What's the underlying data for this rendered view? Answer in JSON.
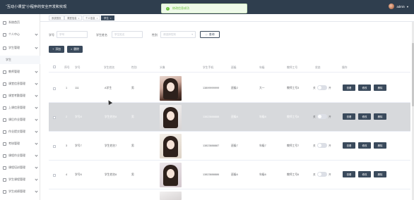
{
  "app": {
    "title": "“互动小课堂”小程序的安全开发和实现",
    "user": "admin"
  },
  "toast": {
    "text": "修改信息成功"
  },
  "sidebar": {
    "items": [
      {
        "label": "系统首页",
        "icon": "home-icon"
      },
      {
        "label": "个人中心",
        "icon": "user-icon"
      },
      {
        "label": "学生管理",
        "icon": "student-icon"
      },
      {
        "label": "学生",
        "icon": ""
      },
      {
        "label": "教师管理",
        "icon": "teacher-icon"
      },
      {
        "label": "课堂信息管理",
        "icon": "grid-icon"
      },
      {
        "label": "课堂考勤管理",
        "icon": "grid-icon"
      },
      {
        "label": "上课信息管理",
        "icon": "grid-icon"
      },
      {
        "label": "课后作业管理",
        "icon": "grid-icon"
      },
      {
        "label": "作业提交管理",
        "icon": "grid-icon"
      },
      {
        "label": "考核管理",
        "icon": "grid-icon"
      },
      {
        "label": "课程作业管理",
        "icon": "grid-icon"
      },
      {
        "label": "课程培训管理",
        "icon": "grid-icon"
      },
      {
        "label": "学生课程管理",
        "icon": "grid-icon"
      },
      {
        "label": "学生成绩管理",
        "icon": "grid-icon"
      }
    ]
  },
  "tabs": [
    {
      "label": "系统首页"
    },
    {
      "label": "课堂信息"
    },
    {
      "label": "个人信息"
    },
    {
      "label": "学生"
    }
  ],
  "search": {
    "fields": [
      {
        "label": "学号",
        "placeholder": "学号"
      },
      {
        "label": "学生姓名",
        "placeholder": "学生姓名"
      },
      {
        "label": "性别",
        "placeholder": "请选择性别"
      }
    ],
    "query_label": "查询"
  },
  "toolbar": {
    "add_label": "添加",
    "delete_label": "删除"
  },
  "table": {
    "headers": [
      "序号",
      "学号",
      "学生姓名",
      "性别",
      "头像",
      "学生手机",
      "班级",
      "年级",
      "教师工号",
      "状态",
      "操作"
    ],
    "rows": [
      {
        "index": "1",
        "student_no": "111",
        "name": "A学生",
        "gender": "男",
        "phone": "13899999999",
        "class": "班级2",
        "grade": "大一",
        "teacher_no": "教师工号3",
        "status_off": "关",
        "status_on": "开"
      },
      {
        "index": "2",
        "student_no": "学号8",
        "name": "学生姓名8",
        "gender": "男",
        "phone": "13823888888",
        "class": "班级8",
        "grade": "年级8",
        "teacher_no": "教师工号8",
        "status_off": "关",
        "status_on": "开"
      },
      {
        "index": "3",
        "student_no": "学号7",
        "name": "学生姓名7",
        "gender": "男",
        "phone": "13823888887",
        "class": "班级7",
        "grade": "年级7",
        "teacher_no": "教师工号7",
        "status_off": "关",
        "status_on": "开"
      },
      {
        "index": "4",
        "student_no": "学号6",
        "name": "学生姓名6",
        "gender": "男",
        "phone": "13823888886",
        "class": "班级6",
        "grade": "年级6",
        "teacher_no": "教师工号6",
        "status_off": "关",
        "status_on": "开"
      }
    ],
    "actions": {
      "view": "查看",
      "edit": "修改",
      "delete": "删除"
    }
  },
  "colors": {
    "topbar": "#2f3e4e",
    "accent": "#3a4a5c",
    "success": "#67c23a"
  }
}
